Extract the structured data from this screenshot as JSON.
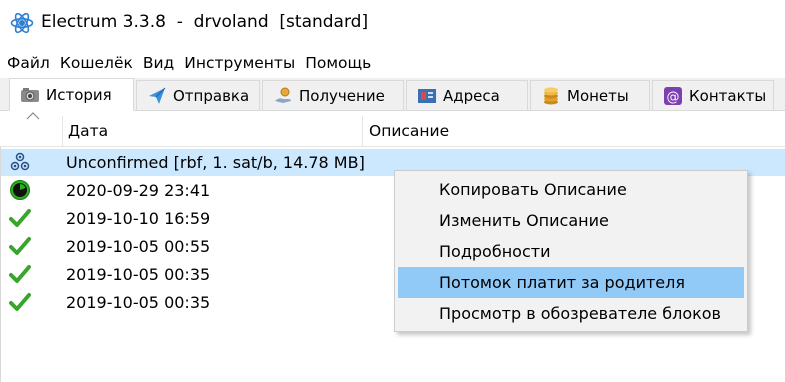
{
  "window": {
    "title": "Electrum 3.3.8  -  drvoland  [standard]",
    "app_icon": "electrum-atom-icon"
  },
  "menu": {
    "items": [
      "Файл",
      "Кошелёк",
      "Вид",
      "Инструменты",
      "Помощь"
    ]
  },
  "tabs": [
    {
      "label": "История",
      "icon": "history-icon",
      "active": true
    },
    {
      "label": "Отправка",
      "icon": "send-paper-plane-icon",
      "active": false
    },
    {
      "label": "Получение",
      "icon": "receive-hand-coin-icon",
      "active": false
    },
    {
      "label": "Адреса",
      "icon": "addresses-icon",
      "active": false
    },
    {
      "label": "Монеты",
      "icon": "coins-stack-icon",
      "active": false
    },
    {
      "label": "Контакты",
      "icon": "contacts-icon",
      "active": false
    }
  ],
  "history_table": {
    "columns": [
      "Дата",
      "Описание"
    ],
    "rows": [
      {
        "date": "Unconfirmed [rbf, 1. sat/b, 14.78 MB]",
        "status_icon": "unconfirmed-gears-icon",
        "selected": true
      },
      {
        "date": "2020-09-29 23:41",
        "status_icon": "clock-pending-icon",
        "selected": false
      },
      {
        "date": "2019-10-10 16:59",
        "status_icon": "confirmed-check-icon",
        "selected": false
      },
      {
        "date": "2019-10-05 00:55",
        "status_icon": "confirmed-check-icon",
        "selected": false
      },
      {
        "date": "2019-10-05 00:35",
        "status_icon": "confirmed-check-icon",
        "selected": false
      },
      {
        "date": "2019-10-05 00:35",
        "status_icon": "confirmed-check-icon",
        "selected": false
      }
    ]
  },
  "context_menu": {
    "items": [
      {
        "label": "Копировать Описание",
        "highlighted": false
      },
      {
        "label": "Изменить Описание",
        "highlighted": false
      },
      {
        "label": "Подробности",
        "highlighted": false
      },
      {
        "label": "Потомок платит за родителя",
        "highlighted": true
      },
      {
        "label": "Просмотр в обозревателе блоков",
        "highlighted": false
      }
    ]
  },
  "colors": {
    "selected_row": "#cce8ff",
    "menu_highlight": "#91c9f7",
    "check_green": "#3aa52c",
    "clock_green": "#27b11f"
  }
}
